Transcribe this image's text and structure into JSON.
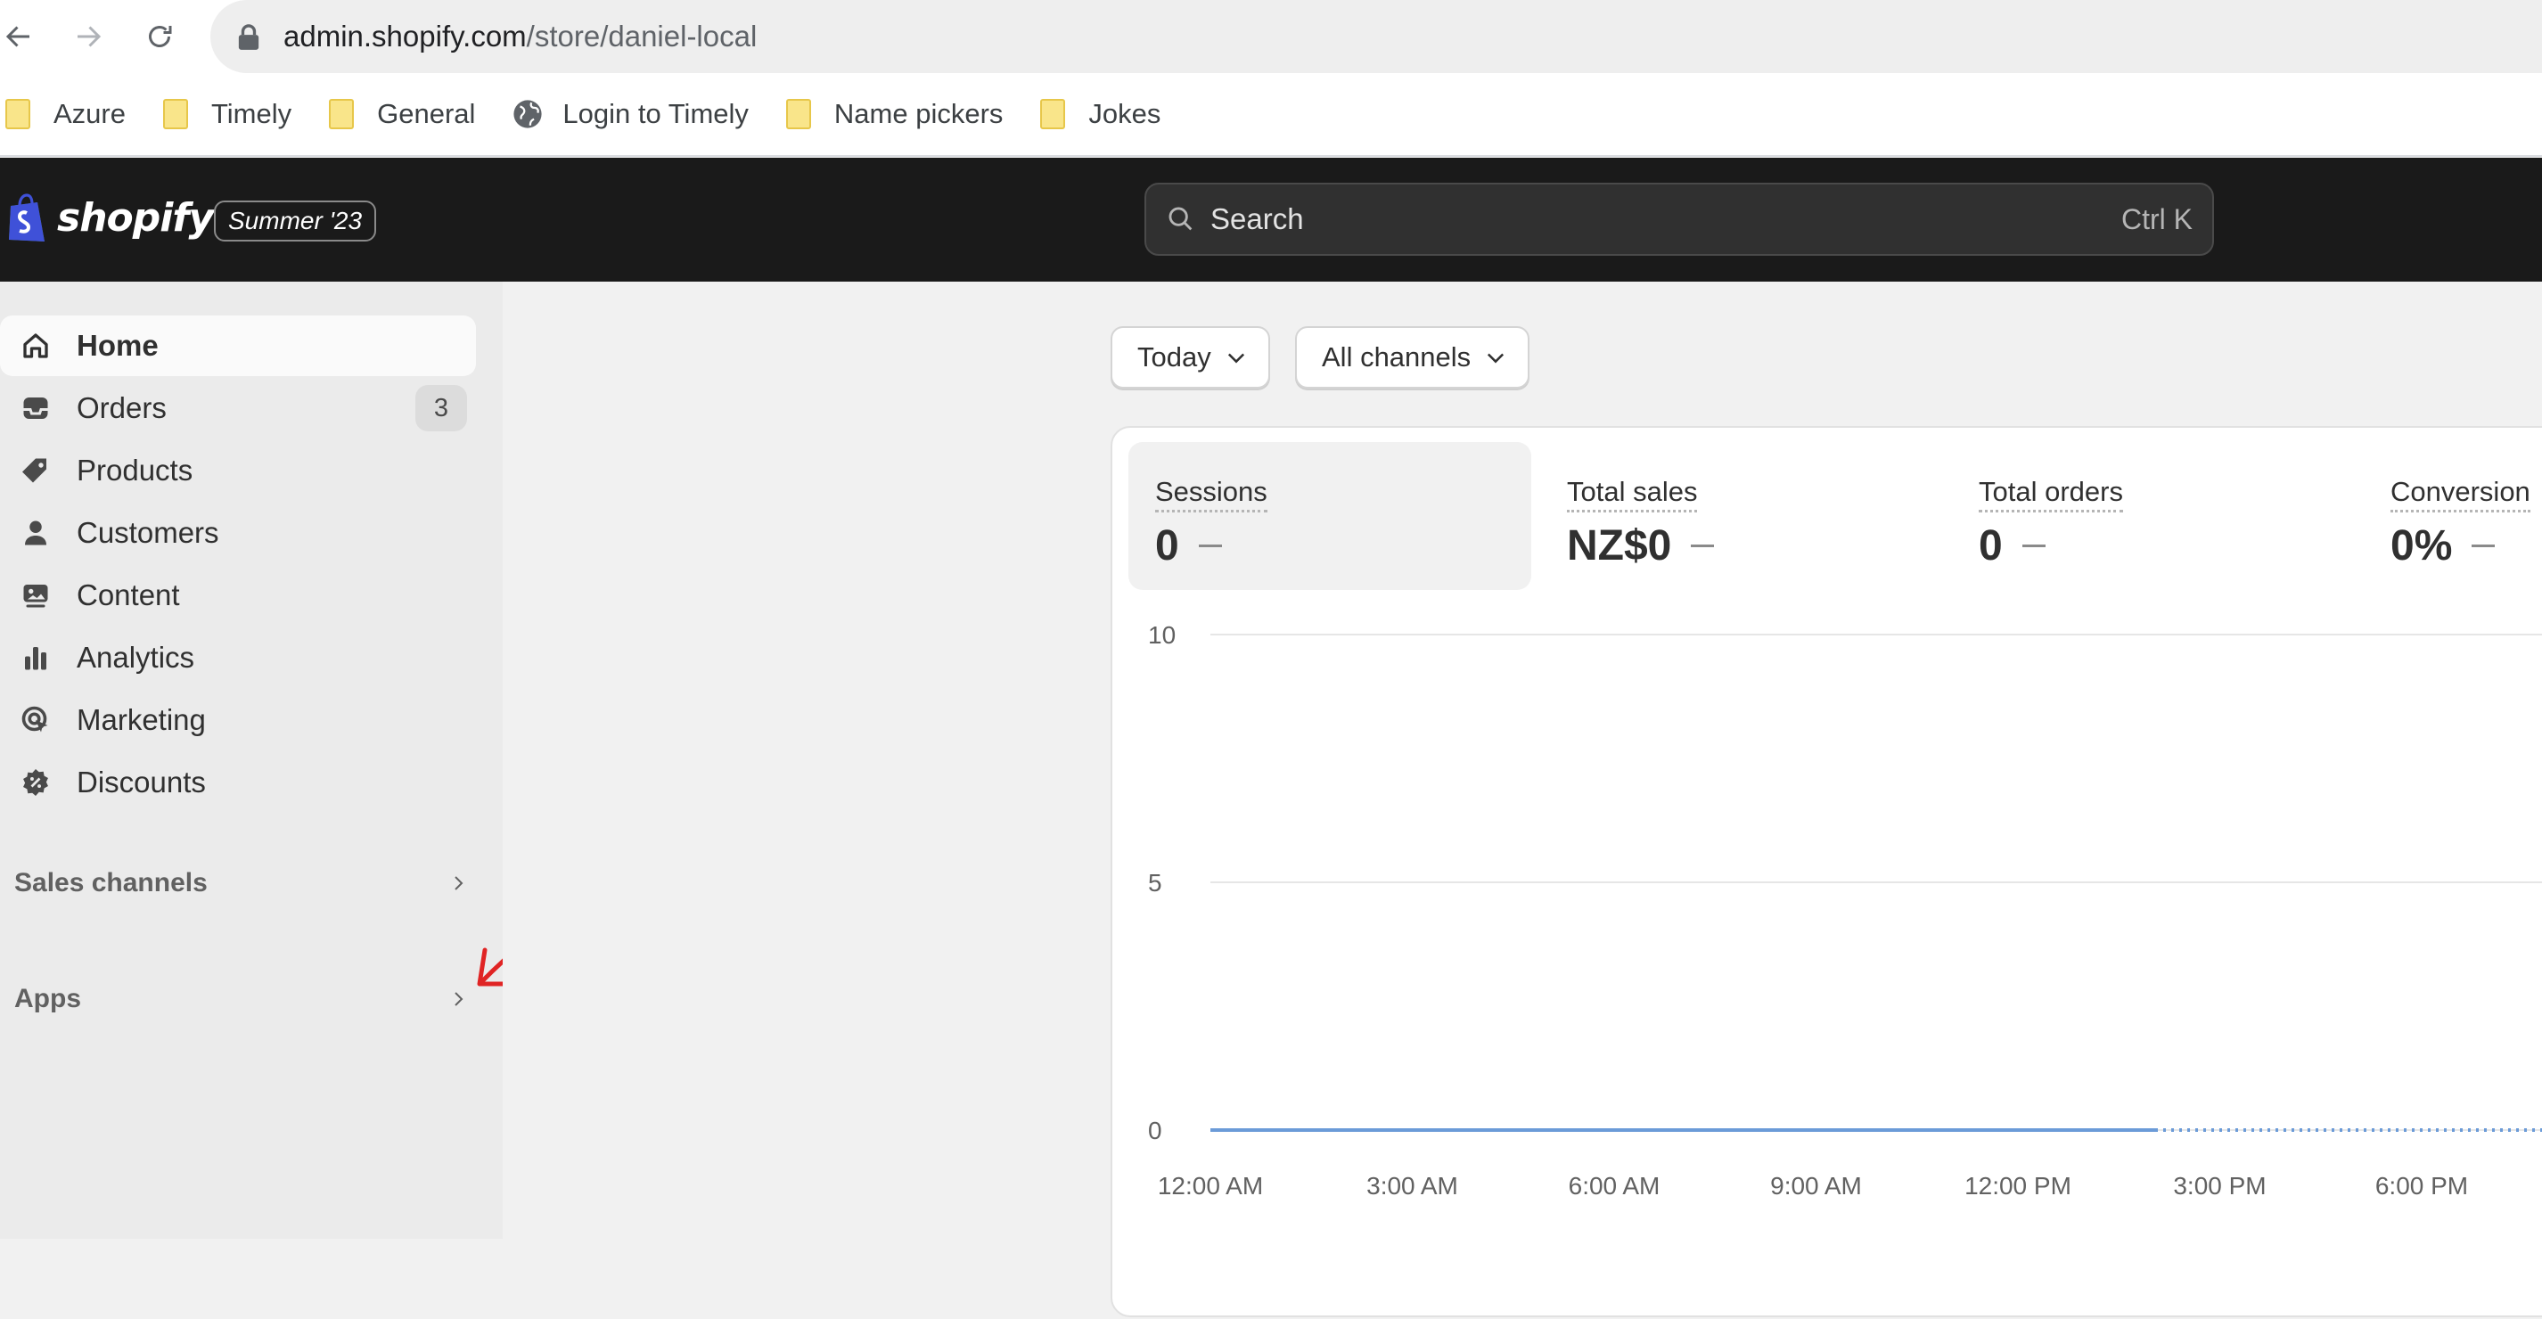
{
  "browser": {
    "url_host": "admin.shopify.com",
    "url_path": "/store/daniel-local",
    "bookmarks": [
      {
        "label": "Azure",
        "icon": "folder-icon"
      },
      {
        "label": "Timely",
        "icon": "folder-icon"
      },
      {
        "label": "General",
        "icon": "folder-icon"
      },
      {
        "label": "Login to Timely",
        "icon": "globe-icon"
      },
      {
        "label": "Name pickers",
        "icon": "folder-icon"
      },
      {
        "label": "Jokes",
        "icon": "folder-icon"
      }
    ]
  },
  "topbar": {
    "brand": "shopify",
    "edition": "Summer '23",
    "search_placeholder": "Search",
    "search_shortcut": "Ctrl K"
  },
  "sidebar": {
    "items": [
      {
        "label": "Home",
        "icon": "home-icon",
        "active": true
      },
      {
        "label": "Orders",
        "icon": "inbox-icon",
        "badge": "3"
      },
      {
        "label": "Products",
        "icon": "tag-icon"
      },
      {
        "label": "Customers",
        "icon": "person-icon"
      },
      {
        "label": "Content",
        "icon": "content-icon"
      },
      {
        "label": "Analytics",
        "icon": "bar-chart-icon"
      },
      {
        "label": "Marketing",
        "icon": "target-icon"
      },
      {
        "label": "Discounts",
        "icon": "discount-icon"
      }
    ],
    "sections": [
      {
        "label": "Sales channels"
      },
      {
        "label": "Apps"
      }
    ]
  },
  "filters": {
    "date": "Today",
    "channel": "All channels"
  },
  "metrics": [
    {
      "label": "Sessions",
      "value": "0"
    },
    {
      "label": "Total sales",
      "value": "NZ$0"
    },
    {
      "label": "Total orders",
      "value": "0"
    },
    {
      "label": "Conversion",
      "value": "0%"
    }
  ],
  "chart_data": {
    "type": "line",
    "x": [
      "12:00 AM",
      "3:00 AM",
      "6:00 AM",
      "9:00 AM",
      "12:00 PM",
      "3:00 PM",
      "6:00 PM"
    ],
    "y_ticks": [
      "10",
      "5",
      "0"
    ],
    "ylim": [
      0,
      10
    ],
    "series": [
      {
        "values": [
          0,
          0,
          0,
          0,
          0,
          0,
          0
        ]
      }
    ],
    "grid": true,
    "colors": {
      "line": "#6b9bd8"
    }
  },
  "colors": {
    "topbar": "#1a1a1a",
    "sidebar": "#ebebeb",
    "annotation_arrow": "#e02424"
  }
}
